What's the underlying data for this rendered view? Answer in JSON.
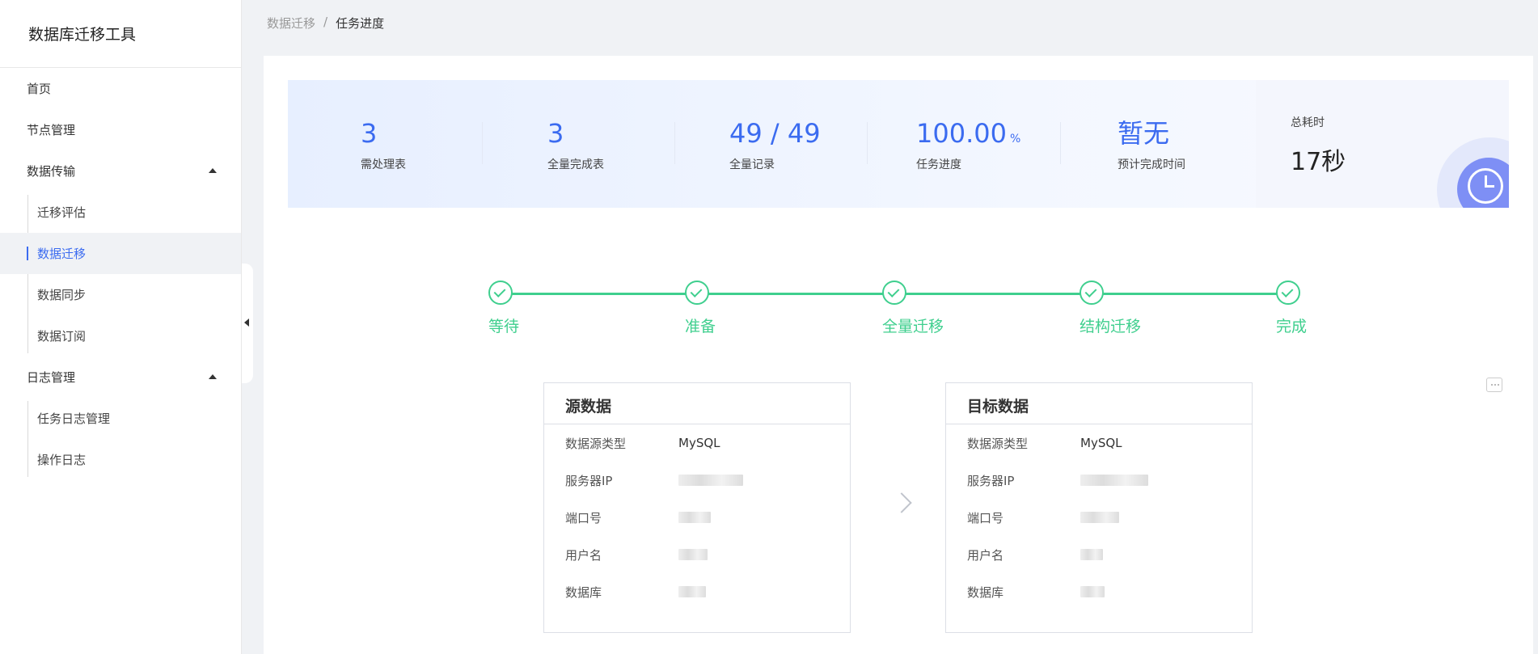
{
  "app": {
    "title": "数据库迁移工具"
  },
  "sidebar": {
    "items": [
      {
        "label": "首页"
      },
      {
        "label": "节点管理"
      },
      {
        "label": "数据传输",
        "children": [
          {
            "label": "迁移评估"
          },
          {
            "label": "数据迁移",
            "active": true
          },
          {
            "label": "数据同步"
          },
          {
            "label": "数据订阅"
          }
        ]
      },
      {
        "label": "日志管理",
        "children": [
          {
            "label": "任务日志管理"
          },
          {
            "label": "操作日志"
          }
        ]
      }
    ]
  },
  "breadcrumb": {
    "parent": "数据迁移",
    "separator": "/",
    "current": "任务进度"
  },
  "stats": [
    {
      "value": "3",
      "label": "需处理表"
    },
    {
      "value": "3",
      "label": "全量完成表"
    },
    {
      "value": "49 / 49",
      "label": "全量记录"
    },
    {
      "value": "100.00",
      "unit": "%",
      "label": "任务进度"
    },
    {
      "value": "暂无",
      "label": "预计完成时间"
    }
  ],
  "total": {
    "label": "总耗时",
    "value": "17秒"
  },
  "steps": [
    {
      "label": "等待",
      "done": true
    },
    {
      "label": "准备",
      "done": true
    },
    {
      "label": "全量迁移",
      "done": true
    },
    {
      "label": "结构迁移",
      "done": true
    },
    {
      "label": "完成",
      "done": true
    }
  ],
  "source": {
    "title": "源数据",
    "rows": [
      {
        "key": "数据源类型",
        "value": "MySQL"
      },
      {
        "key": "服务器IP",
        "value": ""
      },
      {
        "key": "端口号",
        "value": ""
      },
      {
        "key": "用户名",
        "value": ""
      },
      {
        "key": "数据库",
        "value": ""
      }
    ]
  },
  "target": {
    "title": "目标数据",
    "rows": [
      {
        "key": "数据源类型",
        "value": "MySQL"
      },
      {
        "key": "服务器IP",
        "value": ""
      },
      {
        "key": "端口号",
        "value": ""
      },
      {
        "key": "用户名",
        "value": ""
      },
      {
        "key": "数据库",
        "value": ""
      }
    ]
  },
  "colors": {
    "accent": "#3b6bf0",
    "success": "#3fcf8e"
  }
}
